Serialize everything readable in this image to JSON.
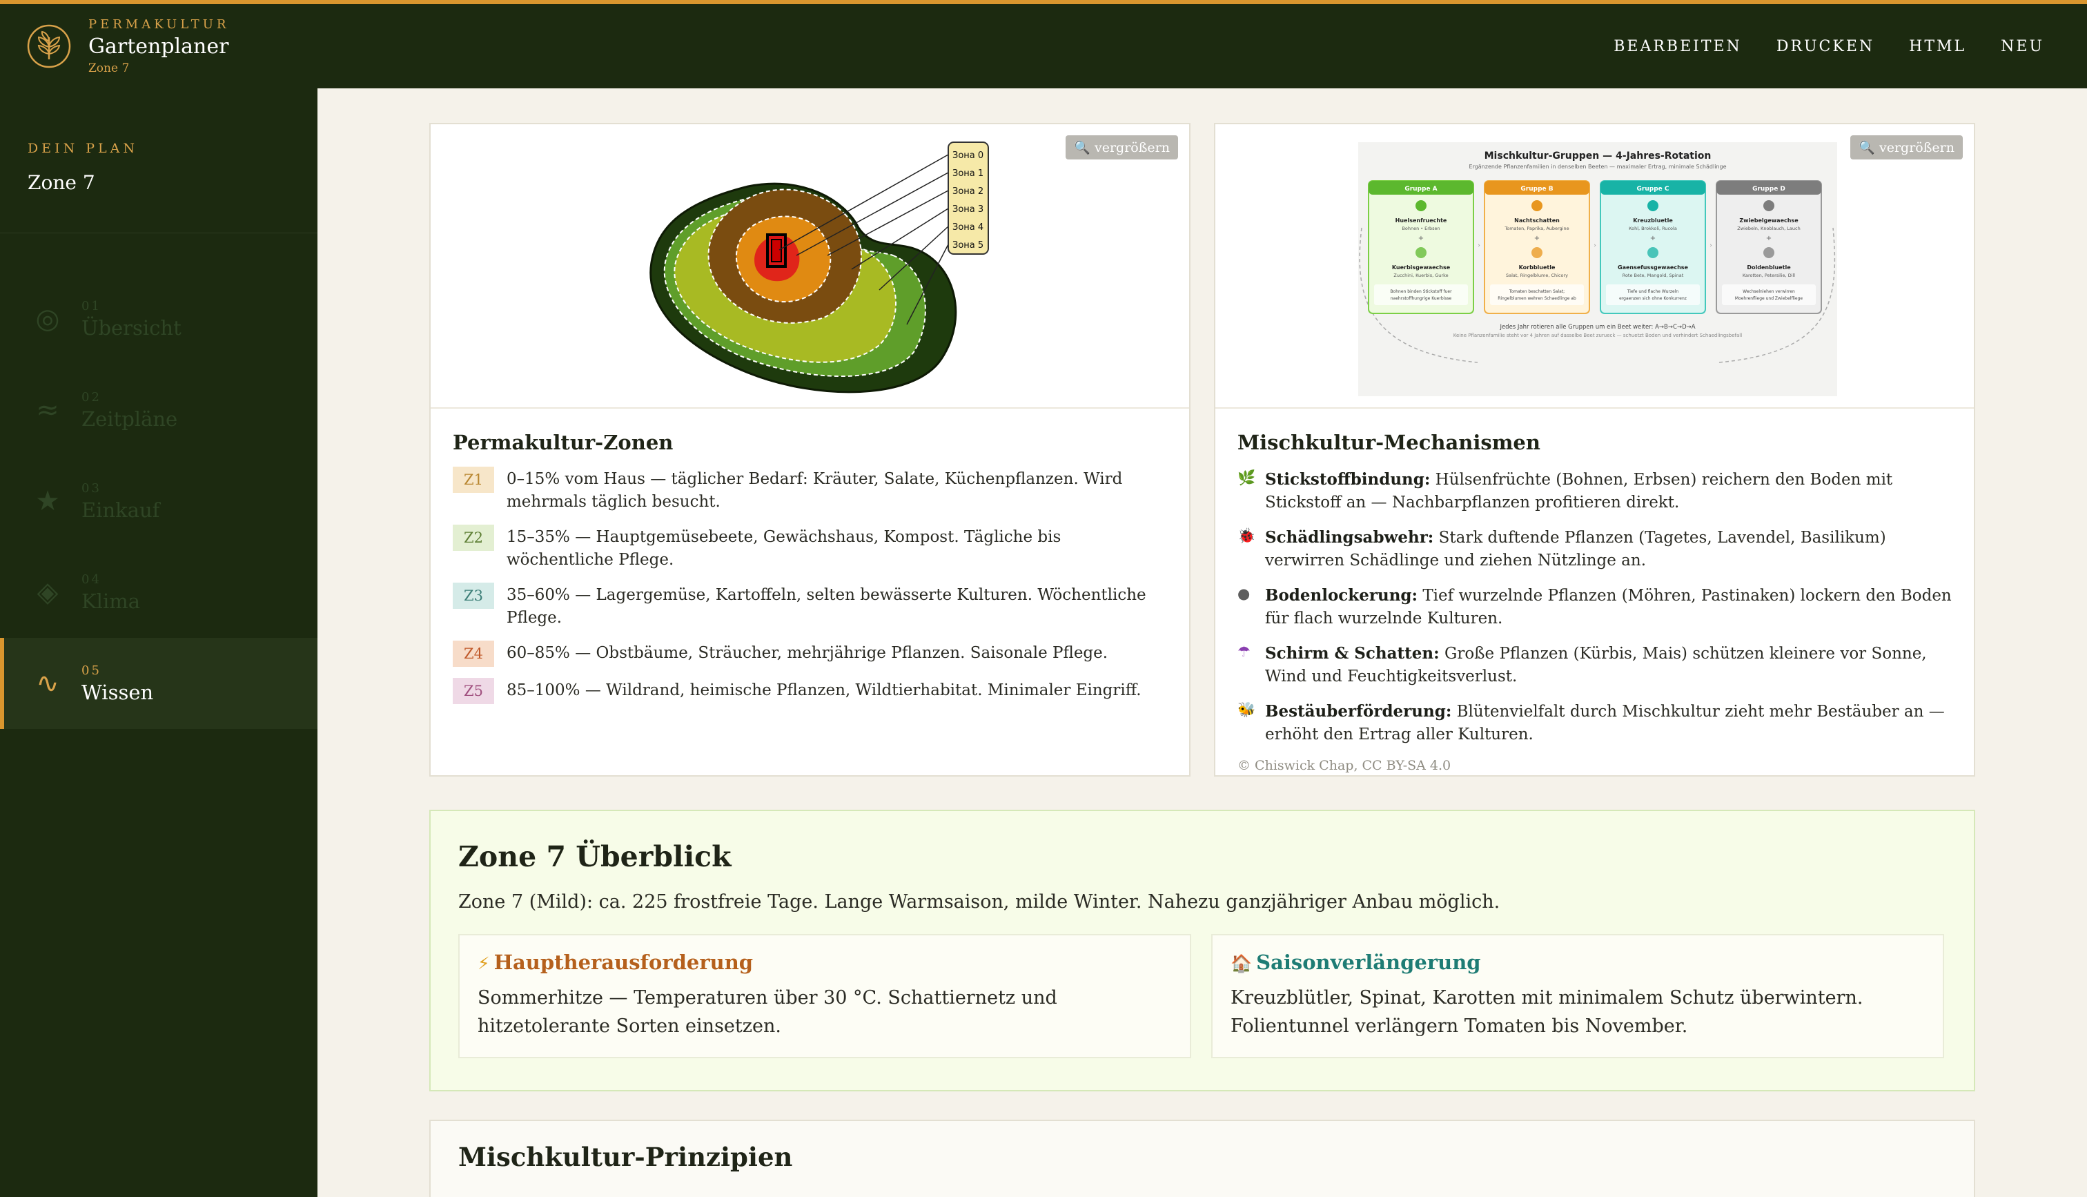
{
  "header": {
    "kicker": "PERMAKULTUR",
    "title": "Gartenplaner",
    "zone": "Zone 7",
    "nav": [
      {
        "label": "BEARBEITEN"
      },
      {
        "label": "DRUCKEN"
      },
      {
        "label": "HTML"
      },
      {
        "label": "NEU"
      }
    ]
  },
  "sidebar": {
    "plan_kicker": "DEIN PLAN",
    "plan_name": "Zone 7",
    "items": [
      {
        "num": "01",
        "label": "Übersicht",
        "icon": "◎",
        "active": false
      },
      {
        "num": "02",
        "label": "Zeitpläne",
        "icon": "≈",
        "active": false
      },
      {
        "num": "03",
        "label": "Einkauf",
        "icon": "★",
        "active": false
      },
      {
        "num": "04",
        "label": "Klima",
        "icon": "◈",
        "active": false
      },
      {
        "num": "05",
        "label": "Wissen",
        "icon": "∿",
        "active": true
      }
    ]
  },
  "zones_card": {
    "zoom_label": "🔍 vergrößern",
    "figure_labels": [
      "Зона 0",
      "Зона 1",
      "Зона 2",
      "Зона 3",
      "Зона 4",
      "Зона 5"
    ],
    "title": "Permakultur-Zonen",
    "zones": [
      {
        "badge": "Z1",
        "text": "0–15% vom Haus — täglicher Bedarf: Kräuter, Salate, Küchenpflanzen. Wird mehrmals täglich besucht.",
        "bg": "#f7e6c9",
        "fg": "#b8862f"
      },
      {
        "badge": "Z2",
        "text": "15–35% — Hauptgemüsebeete, Gewächshaus, Kompost. Tägliche bis wöchentliche Pflege.",
        "bg": "#e3efd2",
        "fg": "#5e7f35"
      },
      {
        "badge": "Z3",
        "text": "35–60% — Lagergemüse, Kartoffeln, selten bewässerte Kulturen. Wöchentliche Pflege.",
        "bg": "#d5ebe8",
        "fg": "#3d7f78"
      },
      {
        "badge": "Z4",
        "text": "60–85% — Obstbäume, Sträucher, mehrjährige Pflanzen. Saisonale Pflege.",
        "bg": "#f7dcc9",
        "fg": "#c0592a"
      },
      {
        "badge": "Z5",
        "text": "85–100% — Wildrand, heimische Pflanzen, Wildtierhabitat. Minimaler Eingriff.",
        "bg": "#efd9e6",
        "fg": "#a04f7e"
      }
    ]
  },
  "mix_card": {
    "zoom_label": "🔍 vergrößern",
    "figure": {
      "title": "Mischkultur-Gruppen — 4-Jahres-Rotation",
      "subtitle": "Ergänzende Pflanzenfamilien in denselben Beeten — maximaler Ertrag, minimale Schädlinge",
      "groups": [
        {
          "name": "Gruppe A",
          "top": "Huelsenfruechte",
          "top_sub": "Bohnen • Erbsen",
          "bottom": "Kuerbisgewaechse",
          "bottom_sub": "Zucchini, Kuerbis, Gurke",
          "note": "Bohnen binden Stickstoff fuer naehrstoffhungrige Kuerbisse",
          "head": "#5cb82e",
          "fill": "#eefae0",
          "border": "#7ccf46"
        },
        {
          "name": "Gruppe B",
          "top": "Nachtschatten",
          "top_sub": "Tomaten, Paprika, Aubergine",
          "bottom": "Korbbluetle",
          "bottom_sub": "Salat, Ringelblume, Chicory",
          "note": "Tomaten beschatten Salat; Ringelblumen wehren Schaedlinge ab",
          "head": "#e8961e",
          "fill": "#fff4dc",
          "border": "#f0b04a"
        },
        {
          "name": "Gruppe C",
          "top": "Kreuzbluetle",
          "top_sub": "Kohl, Brokkoli, Rucola",
          "bottom": "Gaensefussgewaechse",
          "bottom_sub": "Rote Bete, Mangold, Spinat",
          "note": "Tiefe und flache Wurzeln ergaenzen sich ohne Konkurrenz",
          "head": "#18b3a6",
          "fill": "#dcf6f2",
          "border": "#44c8bc"
        },
        {
          "name": "Gruppe D",
          "top": "Zwiebelgewaechse",
          "top_sub": "Zwiebeln, Knoblauch, Lauch",
          "bottom": "Doldenbluetle",
          "bottom_sub": "Karotten, Petersilie, Dill",
          "note": "Wechselnlehen verwirren Moehrenfliege und Zwiebelfliege",
          "head": "#7d7d7d",
          "fill": "#eeeeee",
          "border": "#9a9a9a"
        }
      ],
      "footer": "Jedes Jahr rotieren alle Gruppen um ein Beet weiter: A→B→C→D→A",
      "footer_sub": "Keine Pflanzenfamilie steht vor 4 Jahren auf dasselbe Beet zurueck — schuetzt Boden und verhindert Schaedlingsbefall"
    },
    "title": "Mischkultur-Mechanismen",
    "items": [
      {
        "icon": "🌿",
        "bold": "Stickstoffbindung:",
        "text": " Hülsenfrüchte (Bohnen, Erbsen) reichern den Boden mit Stickstoff an — Nachbarpflanzen profitieren direkt."
      },
      {
        "icon": "🐞",
        "bold": "Schädlingsabwehr:",
        "text": " Stark duftende Pflanzen (Tagetes, Lavendel, Basilikum) verwirren Schädlinge und ziehen Nützlinge an."
      },
      {
        "icon": "●",
        "bold": "Bodenlockerung:",
        "text": " Tief wurzelnde Pflanzen (Möhren, Pastinaken) lockern den Boden für flach wurzelnde Kulturen."
      },
      {
        "icon": "☂",
        "bold": "Schirm & Schatten:",
        "text": " Große Pflanzen (Kürbis, Mais) schützen kleinere vor Sonne, Wind und Feuchtigkeitsverlust."
      },
      {
        "icon": "🐝",
        "bold": "Bestäuberförderung:",
        "text": " Blütenvielfalt durch Mischkultur zieht mehr Bestäuber an — erhöht den Ertrag aller Kulturen."
      }
    ],
    "credit": "© Chiswick Chap, CC BY-SA 4.0"
  },
  "overview": {
    "title": "Zone 7 Überblick",
    "subtitle": "Zone 7 (Mild): ca. 225 frostfreie Tage. Lange Warmsaison, milde Winter. Nahezu ganzjähriger Anbau möglich.",
    "challenge": {
      "icon": "⚡",
      "title": "Hauptherausforderung",
      "text": "Sommerhitze — Temperaturen über 30 °C. Schattiernetz und hitzetolerante Sorten einsetzen.",
      "color": "#b5601c"
    },
    "extension": {
      "icon": "🏠",
      "title": "Saisonverlängerung",
      "text": "Kreuzblütler, Spinat, Karotten mit minimalem Schutz überwintern. Folientunnel verlängern Tomaten bis November.",
      "color": "#1e7c74"
    }
  },
  "principles": {
    "title": "Mischkultur-Prinzipien"
  },
  "colors": {
    "header_bg": "#1c2a10",
    "accent": "#d9962e",
    "page_bg": "#f5f2ea"
  }
}
